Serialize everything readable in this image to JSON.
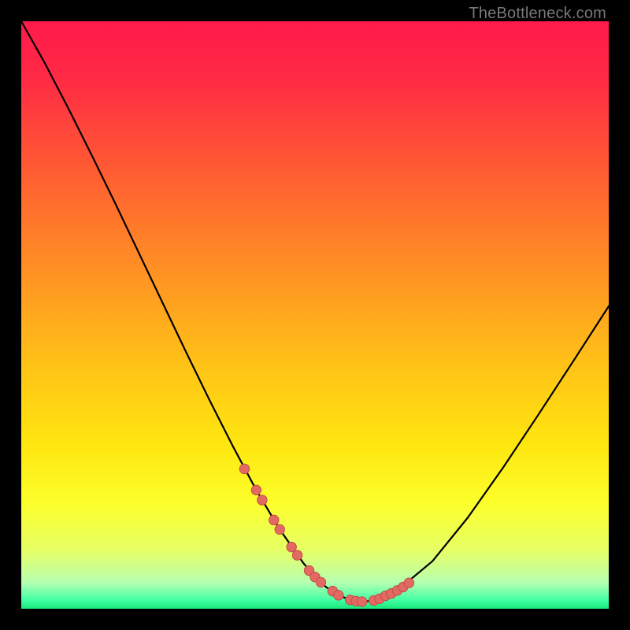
{
  "watermark": {
    "text": "TheBottleneck.com"
  },
  "colors": {
    "frame_bg": "#000000",
    "gradient_stops": [
      {
        "offset": 0.0,
        "color": "#ff1a4b"
      },
      {
        "offset": 0.1,
        "color": "#ff2b44"
      },
      {
        "offset": 0.22,
        "color": "#ff5136"
      },
      {
        "offset": 0.35,
        "color": "#ff7a2a"
      },
      {
        "offset": 0.48,
        "color": "#ffa21f"
      },
      {
        "offset": 0.6,
        "color": "#ffc716"
      },
      {
        "offset": 0.72,
        "color": "#ffe60f"
      },
      {
        "offset": 0.82,
        "color": "#fcff2b"
      },
      {
        "offset": 0.9,
        "color": "#e7ff65"
      },
      {
        "offset": 0.955,
        "color": "#b7ffb0"
      },
      {
        "offset": 0.985,
        "color": "#42ffa5"
      },
      {
        "offset": 1.0,
        "color": "#18e87b"
      }
    ],
    "curve": "#000000",
    "marker_fill": "#e26a62",
    "marker_stroke": "#c24d46"
  },
  "chart_data": {
    "type": "line",
    "title": "",
    "xlabel": "",
    "ylabel": "",
    "xlim": [
      0,
      100
    ],
    "ylim": [
      0,
      100
    ],
    "grid": false,
    "note": "V-shaped bottleneck curve. x is a normalized component-balance axis (0–100); y is mismatch/bottleneck percentage (0 = none, 100 = full). Values estimated from pixel positions.",
    "series": [
      {
        "name": "bottleneck-curve",
        "x": [
          0,
          4,
          8,
          12,
          16,
          20,
          24,
          28,
          32,
          36,
          40,
          44,
          48,
          50,
          52,
          54,
          56,
          58,
          60,
          64,
          70,
          76,
          82,
          88,
          94,
          100
        ],
        "y": [
          100,
          92.9,
          85.2,
          77.2,
          69.0,
          60.6,
          52.2,
          43.8,
          35.6,
          27.7,
          20.2,
          13.5,
          7.8,
          5.4,
          3.6,
          2.3,
          1.5,
          1.2,
          1.4,
          3.1,
          8.1,
          15.5,
          24.0,
          33.0,
          42.2,
          51.5
        ]
      }
    ],
    "markers": {
      "name": "highlighted-points",
      "note": "Dense cluster of markers near the curve minimum and along both flanks (approx x 38–66).",
      "x": [
        38,
        40,
        41,
        43,
        44,
        46,
        47,
        49,
        50,
        51,
        53,
        54,
        56,
        57,
        58,
        60,
        61,
        62,
        63,
        64,
        65,
        66
      ],
      "y": [
        23.8,
        20.2,
        18.5,
        15.1,
        13.5,
        10.5,
        9.1,
        6.5,
        5.4,
        4.5,
        3.0,
        2.3,
        1.5,
        1.3,
        1.2,
        1.4,
        1.7,
        2.2,
        2.6,
        3.1,
        3.7,
        4.4
      ]
    }
  }
}
